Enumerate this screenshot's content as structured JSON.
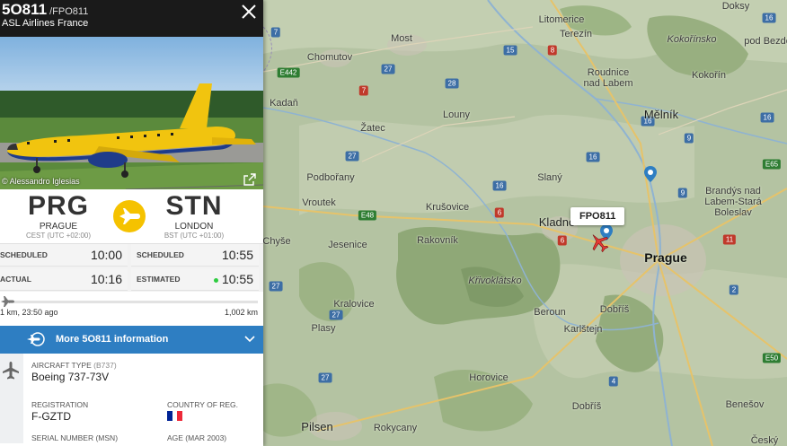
{
  "flight": {
    "number": "5O811",
    "callsign": "/FPO811",
    "airline": "ASL Airlines France"
  },
  "photo": {
    "credit": "© Alessandro Iglesias"
  },
  "route": {
    "from": {
      "code": "PRG",
      "city": "PRAGUE",
      "tz": "CEST (UTC +02:00)"
    },
    "to": {
      "code": "STN",
      "city": "LONDON",
      "tz": "BST (UTC +01:00)"
    }
  },
  "times": {
    "scheduled_label": "SCHEDULED",
    "actual_label": "ACTUAL",
    "estimated_label": "ESTIMATED",
    "dep_scheduled": "10:00",
    "dep_actual": "10:16",
    "arr_scheduled": "10:55",
    "arr_estimated": "10:55"
  },
  "progress": {
    "left_text": "1 km, 23:50 ago",
    "right_text": "1,002 km",
    "fraction": 0.005
  },
  "more": {
    "label": "More 5O811 information"
  },
  "aircraft": {
    "type_label": "AIRCRAFT TYPE",
    "type_code": "(B737)",
    "type_value": "Boeing 737-73V",
    "reg_label": "REGISTRATION",
    "reg_value": "F-GZTD",
    "country_label": "COUNTRY OF REG.",
    "serial_label": "SERIAL NUMBER (MSN)",
    "age_label": "AGE (MAR 2003)"
  },
  "map": {
    "flight_label": "FPO811",
    "places": {
      "most": "Most",
      "litomerice": "Litomerice",
      "terezin": "Terezín",
      "doksy": "Doksy",
      "bela": "Bělá\npod Bezdězem",
      "chomutov": "Chomutov",
      "kokorinsko": "Kokořínsko",
      "roudnice": "Roudnice\nnad Labem",
      "kokorin": "Kokořín",
      "kadan": "Kadaň",
      "louny": "Louny",
      "melnik": "Mělník",
      "zatec": "Žatec",
      "podborany": "Podbořany",
      "slany": "Slaný",
      "brandys": "Brandýs nad\nLabem-Stará\nBoleslav",
      "vroutek": "Vroutek",
      "krusovice": "Krušovice",
      "kladno": "Kladno",
      "chyse": "Chyše",
      "jesenice": "Jesenice",
      "rakovnik": "Rakovník",
      "prague": "Prague",
      "krivoklatsko": "Křivoklátsko",
      "kralovice": "Kralovice",
      "beroun": "Beroun",
      "dobris_forest": "Dobříš",
      "plasy": "Plasy",
      "karlstejn": "Karlštejn",
      "horovice": "Horovice",
      "dobris": "Dobříš",
      "benesov": "Benešov",
      "pilsen": "Pilsen",
      "rokycany": "Rokycany",
      "cesky": "Český"
    },
    "roads": [
      "7",
      "15",
      "8",
      "27",
      "E442",
      "7",
      "28",
      "16",
      "16",
      "9",
      "16",
      "27",
      "16",
      "E65",
      "9",
      "16",
      "E48",
      "6",
      "6",
      "11",
      "27",
      "2",
      "27",
      "E50",
      "27",
      "4",
      "27",
      "E50"
    ]
  }
}
